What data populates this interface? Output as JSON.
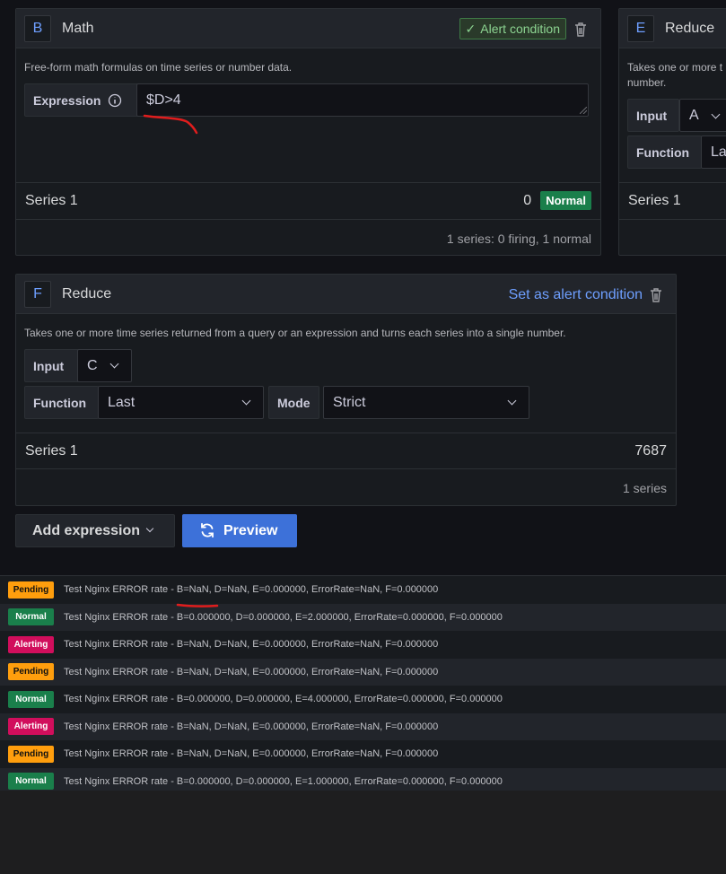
{
  "colors": {
    "normal": "#1a7f4b",
    "pending": "#ff9e0d",
    "alerting": "#d10e5c",
    "link": "#6e9fff",
    "annotation": "#e01d1d"
  },
  "card_b": {
    "ref": "B",
    "title": "Math",
    "alert_condition_label": "Alert condition",
    "description": "Free-form math formulas on time series or number data.",
    "expression_label": "Expression",
    "expression_value": "$D>4",
    "series_name": "Series 1",
    "series_value": "0",
    "series_state": "Normal",
    "footer": "1 series: 0 firing, 1 normal"
  },
  "card_e": {
    "ref": "E",
    "title": "Reduce",
    "description_lines": [
      "Takes one or more t",
      "number."
    ],
    "input_label": "Input",
    "input_value": "A",
    "function_label": "Function",
    "function_value": "La",
    "series_name": "Series 1"
  },
  "card_f": {
    "ref": "F",
    "title": "Reduce",
    "set_condition_label": "Set as alert condition",
    "description": "Takes one or more time series returned from a query or an expression and turns each series into a single number.",
    "input_label": "Input",
    "input_value": "C",
    "function_label": "Function",
    "function_value": "Last",
    "mode_label": "Mode",
    "mode_value": "Strict",
    "series_name": "Series 1",
    "series_value": "7687",
    "footer": "1 series"
  },
  "buttons": {
    "add_expression": "Add expression",
    "preview": "Preview"
  },
  "history": [
    {
      "state": "Pending",
      "text": "Test Nginx ERROR rate - B=NaN, D=NaN, E=0.000000, ErrorRate=NaN, F=0.000000"
    },
    {
      "state": "Normal",
      "text": "Test Nginx ERROR rate - B=0.000000, D=0.000000, E=2.000000, ErrorRate=0.000000, F=0.000000"
    },
    {
      "state": "Alerting",
      "text": "Test Nginx ERROR rate - B=NaN, D=NaN, E=0.000000, ErrorRate=NaN, F=0.000000"
    },
    {
      "state": "Pending",
      "text": "Test Nginx ERROR rate - B=NaN, D=NaN, E=0.000000, ErrorRate=NaN, F=0.000000"
    },
    {
      "state": "Normal",
      "text": "Test Nginx ERROR rate - B=0.000000, D=0.000000, E=4.000000, ErrorRate=0.000000, F=0.000000"
    },
    {
      "state": "Alerting",
      "text": "Test Nginx ERROR rate - B=NaN, D=NaN, E=0.000000, ErrorRate=NaN, F=0.000000"
    },
    {
      "state": "Pending",
      "text": "Test Nginx ERROR rate - B=NaN, D=NaN, E=0.000000, ErrorRate=NaN, F=0.000000"
    },
    {
      "state": "Normal",
      "text": "Test Nginx ERROR rate - B=0.000000, D=0.000000, E=1.000000, ErrorRate=0.000000, F=0.000000"
    }
  ]
}
